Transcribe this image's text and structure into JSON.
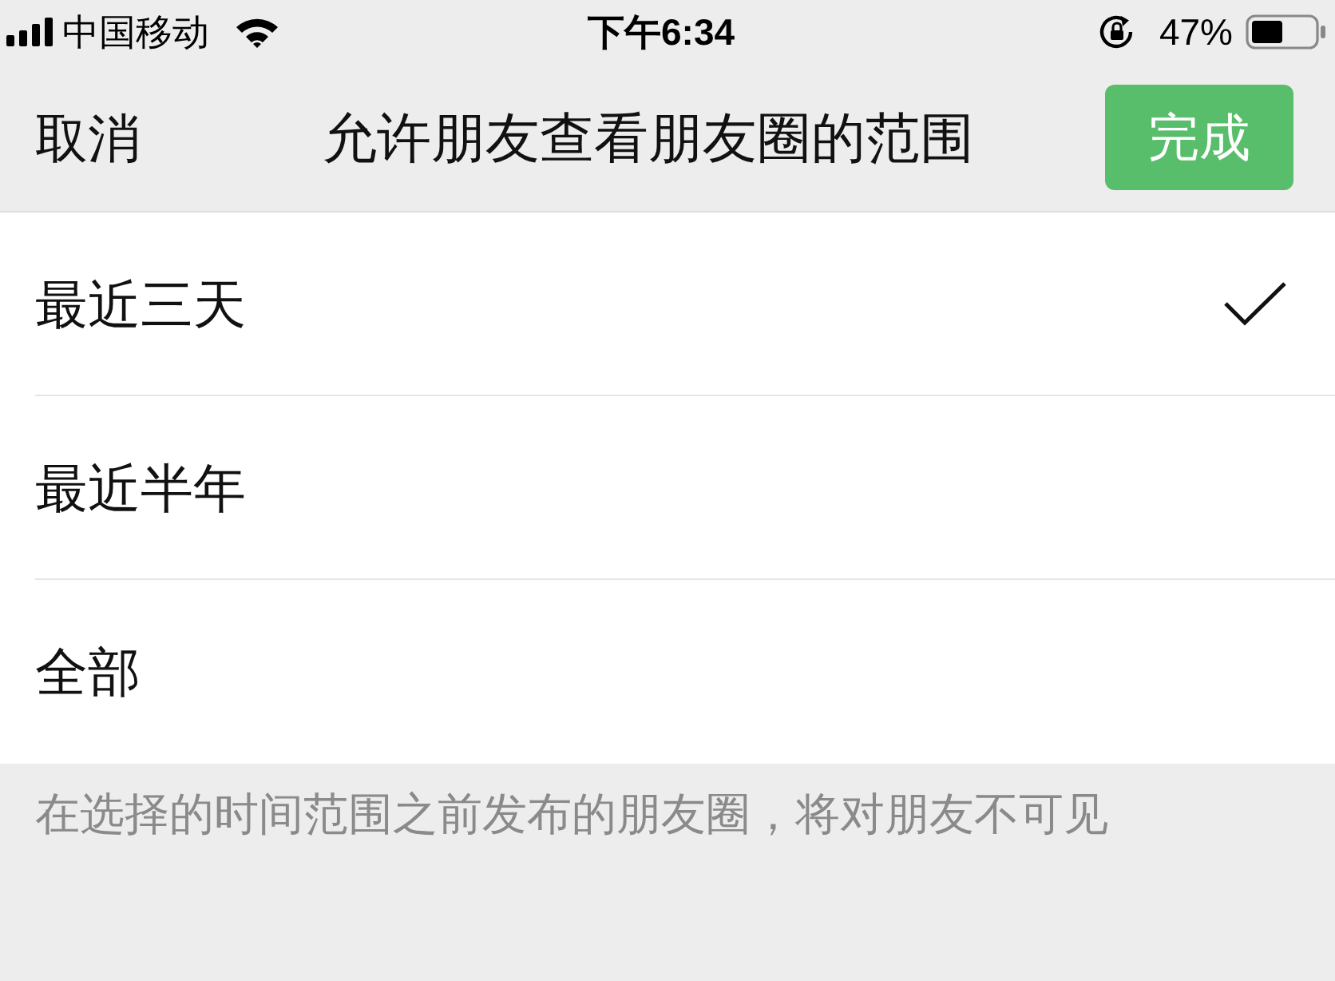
{
  "status_bar": {
    "carrier": "中国移动",
    "time": "下午6:34",
    "battery": "47%"
  },
  "nav_bar": {
    "cancel": "取消",
    "title": "允许朋友查看朋友圈的范围",
    "done": "完成"
  },
  "options": [
    {
      "label": "最近三天",
      "selected": true
    },
    {
      "label": "最近半年",
      "selected": false
    },
    {
      "label": "全部",
      "selected": false
    }
  ],
  "footnote": "在选择的时间范围之前发布的朋友圈，将对朋友不可见"
}
